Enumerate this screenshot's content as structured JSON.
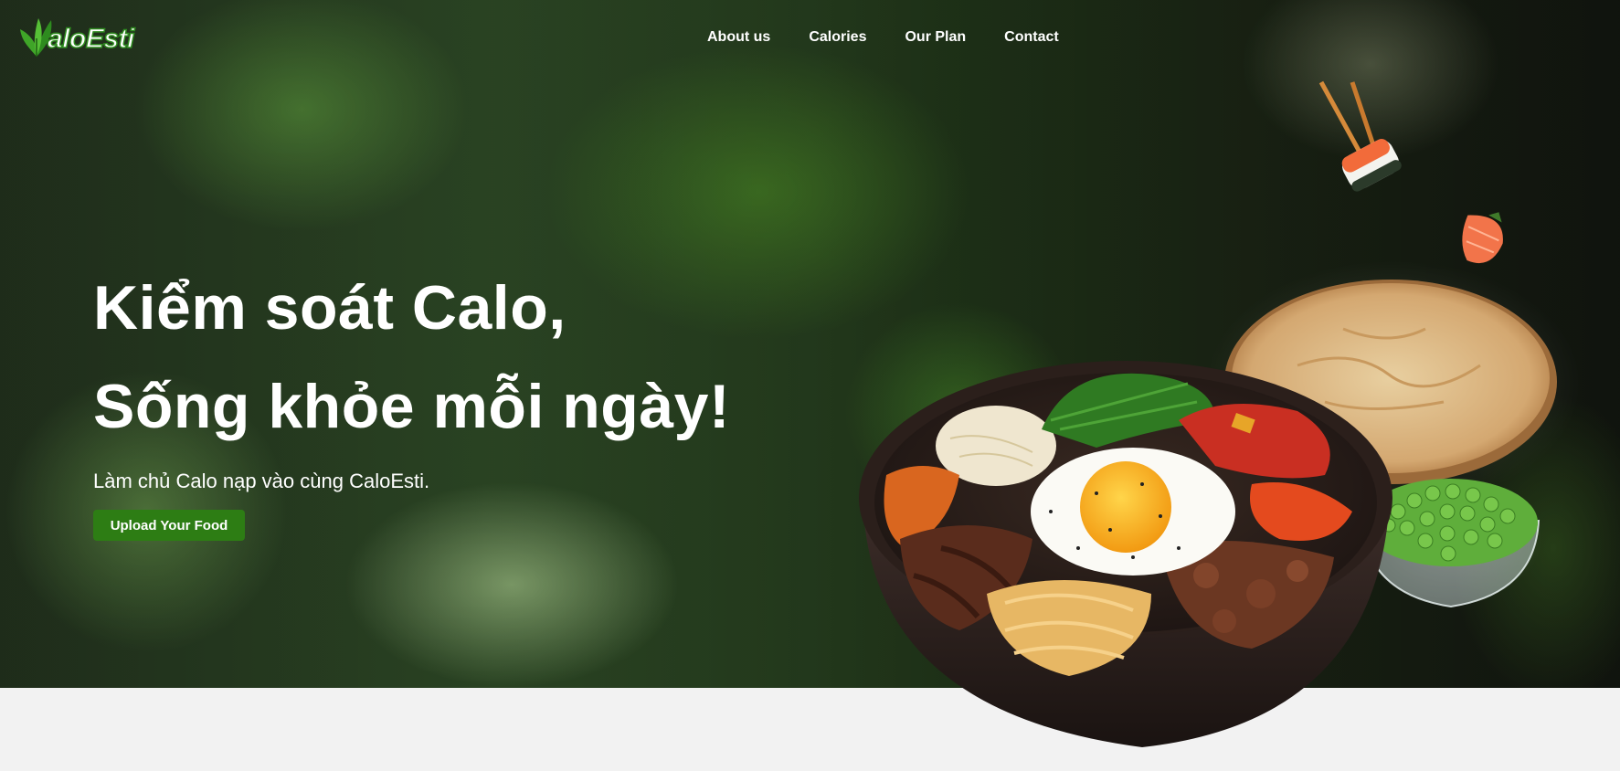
{
  "brand": {
    "logo_text": "aloEsti"
  },
  "nav": {
    "items": [
      "About us",
      "Calories",
      "Our Plan",
      "Contact"
    ]
  },
  "hero": {
    "title_line_1": "Kiểm soát Calo,",
    "title_line_2": "Sống khỏe mỗi ngày!",
    "subtitle": "Làm chủ Calo nạp vào cùng CaloEsti.",
    "cta_label": "Upload Your Food"
  },
  "colors": {
    "accent": "#2d7d14",
    "footer_bg": "#f2f2f2",
    "text_on_hero": "#ffffff"
  }
}
